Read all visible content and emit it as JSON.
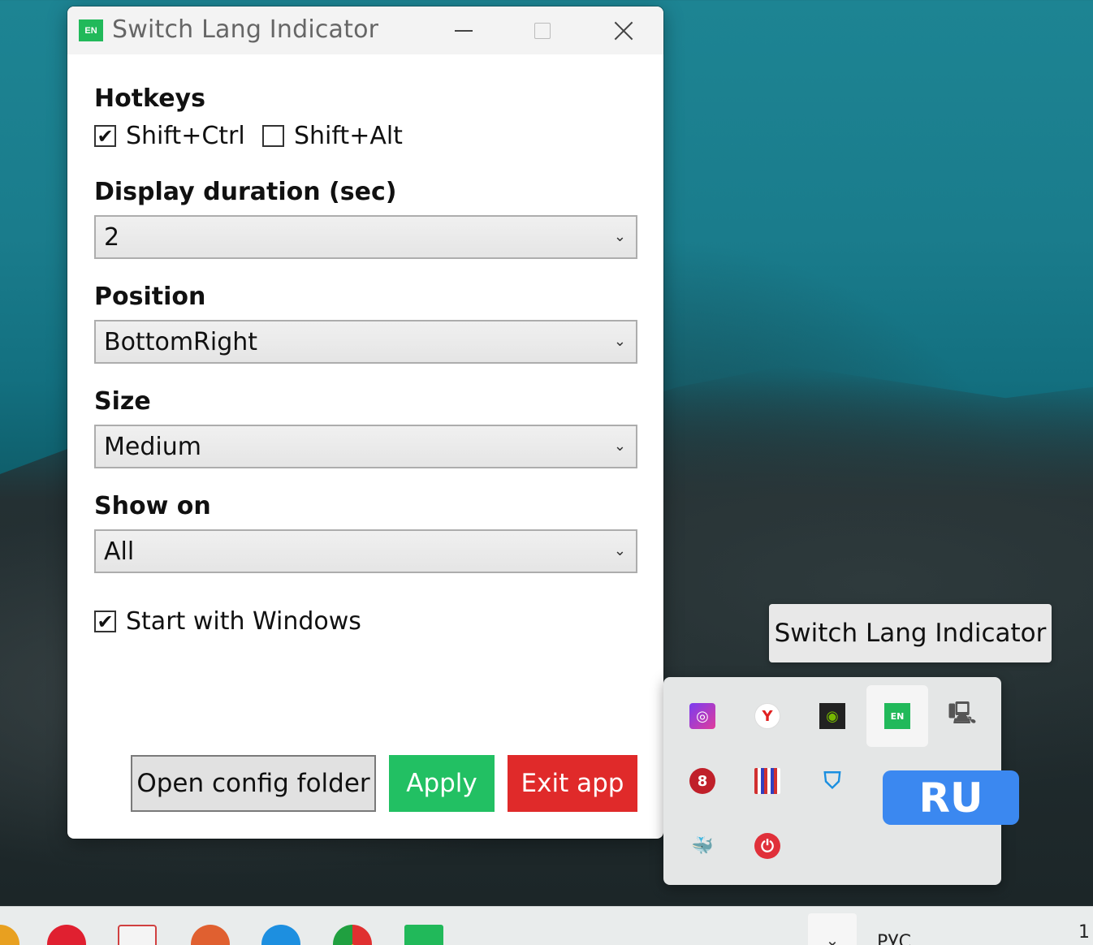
{
  "window": {
    "title": "Switch Lang Indicator",
    "icon_text": "EN"
  },
  "hotkeys": {
    "label": "Hotkeys",
    "options": [
      {
        "label": "Shift+Ctrl",
        "checked": true
      },
      {
        "label": "Shift+Alt",
        "checked": false
      }
    ]
  },
  "duration": {
    "label": "Display duration (sec)",
    "value": "2"
  },
  "position": {
    "label": "Position",
    "value": "BottomRight"
  },
  "size": {
    "label": "Size",
    "value": "Medium"
  },
  "show_on": {
    "label": "Show on",
    "value": "All"
  },
  "startup": {
    "label": "Start with Windows",
    "checked": true
  },
  "buttons": {
    "open_config": "Open config folder",
    "apply": "Apply",
    "exit": "Exit app"
  },
  "tooltip": "Switch Lang Indicator",
  "tray": {
    "icons": [
      "podcast-icon",
      "yandex-browser-icon",
      "nvidia-icon",
      "switch-lang-en-icon",
      "network-monitor-icon",
      "record-app-icon",
      "grid-app-icon",
      "security-shield-icon",
      "docker-icon",
      "power-icon"
    ],
    "en_label": "EN"
  },
  "indicator": "RU",
  "taskbar": {
    "lang": "РУС",
    "time": "1"
  },
  "colors": {
    "apply": "#22c063",
    "exit": "#e02a2a",
    "indicator": "#3b88f0",
    "app_icon": "#21b95a"
  }
}
